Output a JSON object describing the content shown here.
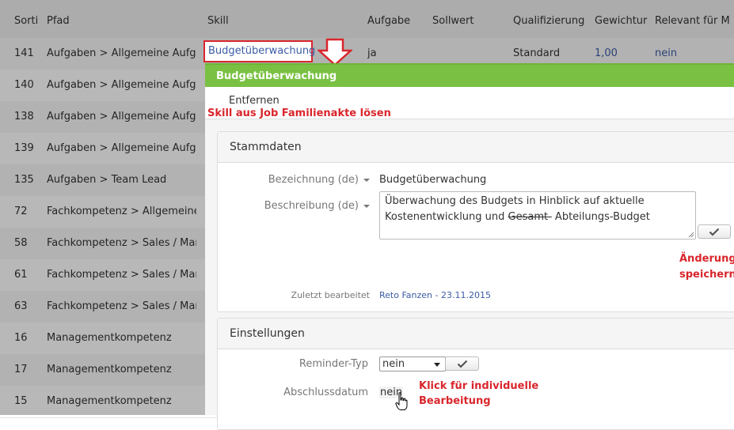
{
  "table": {
    "headers": [
      "Sorti",
      "Pfad",
      "Skill",
      "Aufgabe",
      "Sollwert",
      "Qualifizierung",
      "Gewichtur",
      "Relevant für M"
    ],
    "first_row": {
      "sort": "141",
      "path": "Aufgaben > Allgemeine Aufgabe",
      "skill": "Budgetüberwachung",
      "task": "ja",
      "qualification": "Standard",
      "weight": "1,00",
      "relevant": "nein"
    },
    "rows": [
      {
        "sort": "140",
        "path": "Aufgaben > Allgemeine Aufgabe"
      },
      {
        "sort": "138",
        "path": "Aufgaben > Allgemeine Aufgabe"
      },
      {
        "sort": "139",
        "path": "Aufgaben > Allgemeine Aufgabe"
      },
      {
        "sort": "135",
        "path": "Aufgaben > Team Lead"
      },
      {
        "sort": "72",
        "path": "Fachkompetenz > Allgemeines"
      },
      {
        "sort": "58",
        "path": "Fachkompetenz > Sales / Marke"
      },
      {
        "sort": "61",
        "path": "Fachkompetenz > Sales / Marke"
      },
      {
        "sort": "63",
        "path": "Fachkompetenz > Sales / Marke"
      },
      {
        "sort": "16",
        "path": "Managementkompetenz"
      },
      {
        "sort": "17",
        "path": "Managementkompetenz"
      },
      {
        "sort": "15",
        "path": "Managementkompetenz"
      }
    ]
  },
  "panel": {
    "title": "Budgetüberwachung",
    "remove_tab": "Entfernen",
    "annotation_remove": "Skill aus Job Familienakte lösen",
    "stammdaten": {
      "title": "Stammdaten",
      "name_label": "Bezeichnung (de)",
      "name_value": "Budgetüberwachung",
      "desc_label": "Beschreibung (de)",
      "desc_line1": "Überwachung des Budgets in Hinblick auf aktuelle",
      "desc_line2_pre": "Kostenentwicklung und ",
      "desc_line2_strike": "Gesamt-",
      "desc_line2_post": " Abteilungs-Budget",
      "annotation_save_1": "Änderung",
      "annotation_save_2": "speichern",
      "edited_label": "Zuletzt bearbeitet",
      "edited_value": "Reto Fanzen - 23.11.2015"
    },
    "einstellungen": {
      "title": "Einstellungen",
      "reminder_label": "Reminder-Typ",
      "reminder_value": "nein",
      "closing_label": "Abschlussdatum",
      "closing_value": "nein",
      "annotation_edit_1": "Klick für individuelle",
      "annotation_edit_2": "Bearbeitung"
    }
  },
  "colors": {
    "accent_green": "#7ac143",
    "annotation_red": "#d9262c",
    "link_blue": "#3b5ba5"
  },
  "icons": [
    "checkmark-icon",
    "dropdown-caret-icon",
    "down-arrow-icon",
    "hand-cursor-icon"
  ]
}
